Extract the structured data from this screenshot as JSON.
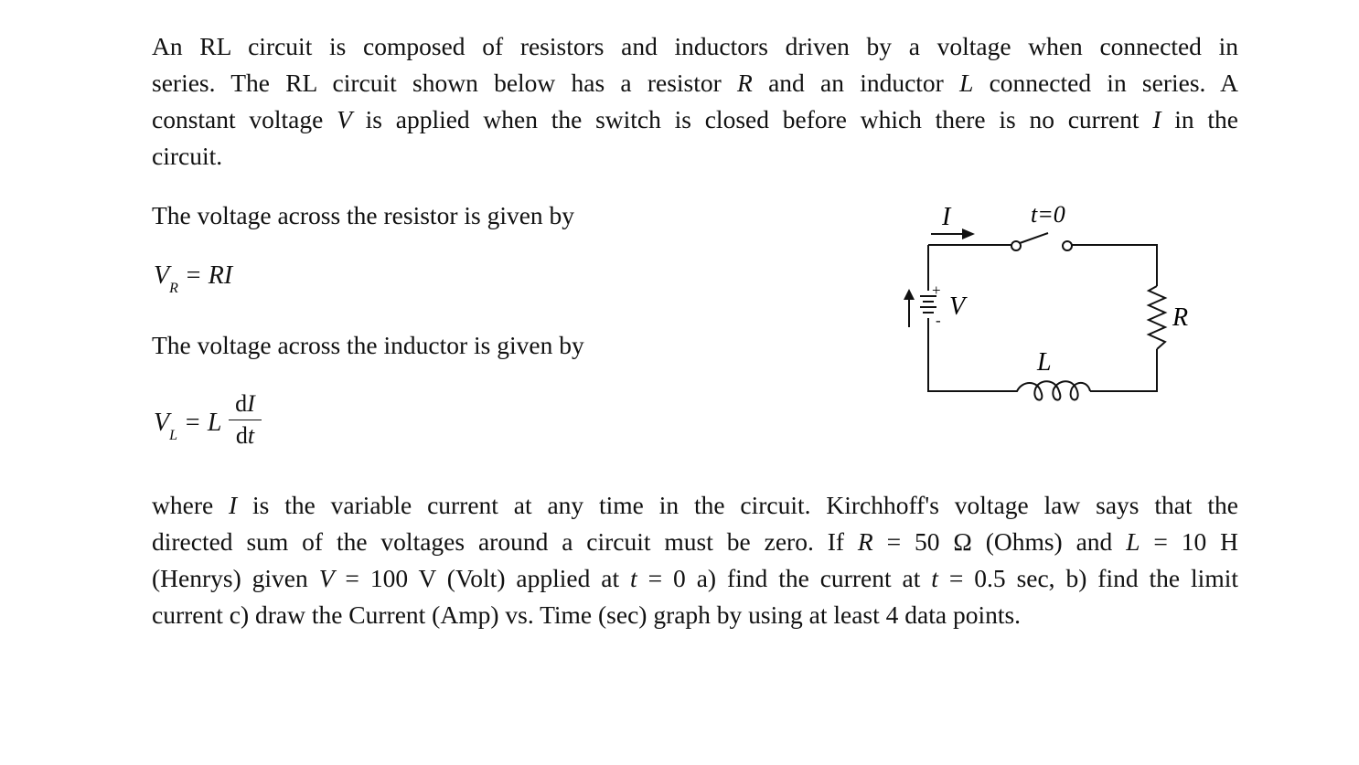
{
  "intro": {
    "lines": [
      [
        "An RL circuit is composed of resistors and inductors  driven by a voltage when connected in"
      ],
      [
        "series. The RL circuit shown below has a resistor ",
        {
          "i": "R"
        },
        " and an inductor ",
        {
          "i": "L"
        },
        " connected in series. A"
      ],
      [
        "constant voltage ",
        {
          "i": "V"
        },
        " is applied when the switch is closed before which there is no current ",
        {
          "i": "I"
        },
        " in the"
      ],
      [
        "circuit."
      ]
    ]
  },
  "resistor_heading": "The voltage across the resistor is given by",
  "eq_resistor": {
    "lhs": "V",
    "sub": "R",
    "rhs": "= RI"
  },
  "inductor_heading": "The voltage across the inductor is given by",
  "eq_inductor": {
    "lhs": "V",
    "sub": "L",
    "eq": "= L",
    "num": "dI",
    "den": "dt"
  },
  "circuit": {
    "current_label": "I",
    "switch_label": "t=0",
    "source_label": "V",
    "plus": "+",
    "minus": "-",
    "resistor_label": "R",
    "inductor_label": "L"
  },
  "problem": {
    "lines": [
      [
        "where ",
        {
          "i": "I"
        },
        " is the variable current at any time in the circuit. Kirchhoff's voltage law says that the"
      ],
      [
        "directed sum of the voltages around a circuit must be zero. If ",
        {
          "i": "R"
        },
        " = 50 Ω (Ohms) and ",
        {
          "i": "L"
        },
        " = 10 H"
      ],
      [
        "(Henrys) given ",
        {
          "i": "V"
        },
        " = 100 V (Volt) applied at ",
        {
          "i": "t"
        },
        " = 0 a) find the current at ",
        {
          "i": "t"
        },
        " = 0.5 sec, b) find the limit"
      ],
      [
        "current c) draw the Current (Amp) vs. Time (sec) graph by using at least 4 data points."
      ]
    ]
  }
}
